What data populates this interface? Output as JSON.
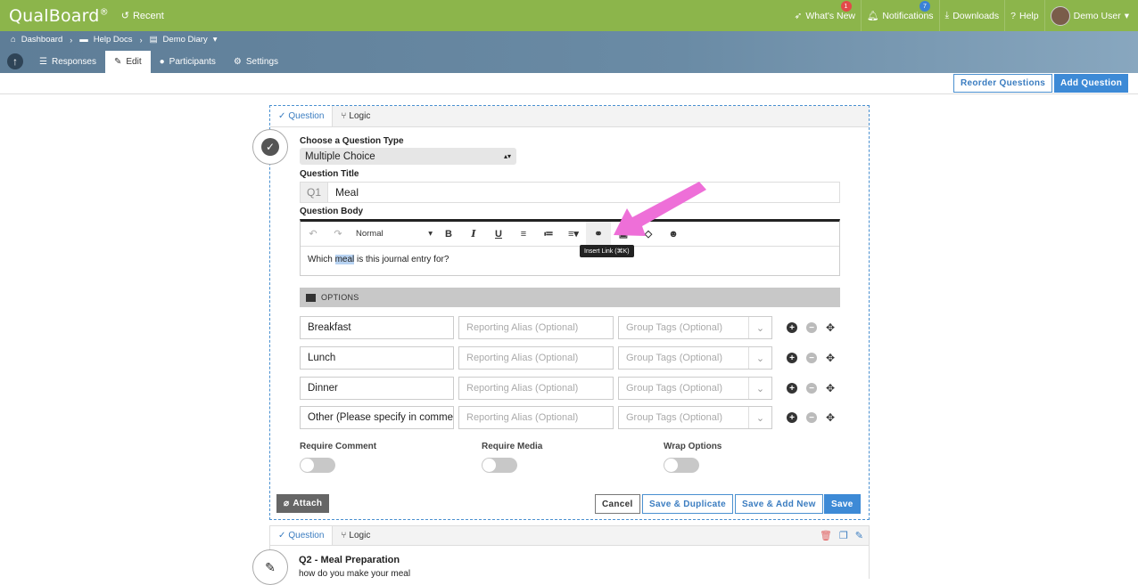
{
  "app": {
    "logo": "QualBoard",
    "logo_mark": "®",
    "recent_label": "Recent"
  },
  "topnav": {
    "whats_new": "What's New",
    "whats_new_badge": "1",
    "notifications": "Notifications",
    "notifications_badge": "7",
    "downloads": "Downloads",
    "help": "Help",
    "user": "Demo User"
  },
  "breadcrumb": [
    "Dashboard",
    "Help Docs",
    "Demo Diary"
  ],
  "tabs": [
    "Responses",
    "Edit",
    "Participants",
    "Settings"
  ],
  "actions": {
    "reorder": "Reorder Questions",
    "add": "Add Question"
  },
  "question": {
    "tab_question": "Question",
    "tab_logic": "Logic",
    "type_label": "Choose a Question Type",
    "type_value": "Multiple Choice",
    "title_label": "Question Title",
    "title_prefix": "Q1",
    "title_value": "Meal",
    "body_label": "Question Body",
    "editor_format": "Normal",
    "tooltip": "Insert Link (⌘K)",
    "body_before": "Which ",
    "body_selected": "meal",
    "body_after": " is this journal entry for?",
    "options_header": "OPTIONS",
    "options": [
      {
        "value": "Breakfast",
        "alias_placeholder": "Reporting Alias (Optional)",
        "tags_placeholder": "Group Tags (Optional)"
      },
      {
        "value": "Lunch",
        "alias_placeholder": "Reporting Alias (Optional)",
        "tags_placeholder": "Group Tags (Optional)"
      },
      {
        "value": "Dinner",
        "alias_placeholder": "Reporting Alias (Optional)",
        "tags_placeholder": "Group Tags (Optional)"
      },
      {
        "value": "Other (Please specify in comme",
        "alias_placeholder": "Reporting Alias (Optional)",
        "tags_placeholder": "Group Tags (Optional)"
      }
    ],
    "toggles": [
      "Require Comment",
      "Require Media",
      "Wrap Options"
    ],
    "attach": "Attach",
    "cancel": "Cancel",
    "save_duplicate": "Save & Duplicate",
    "save_add_new": "Save & Add New",
    "save": "Save"
  },
  "question2": {
    "tab_question": "Question",
    "tab_logic": "Logic",
    "title": "Q2 - Meal Preparation",
    "body": "how do you make your meal"
  },
  "colors": {
    "topbar": "#8cb54b",
    "accent": "#3d8ad6",
    "arrow": "#ee6fd8"
  }
}
